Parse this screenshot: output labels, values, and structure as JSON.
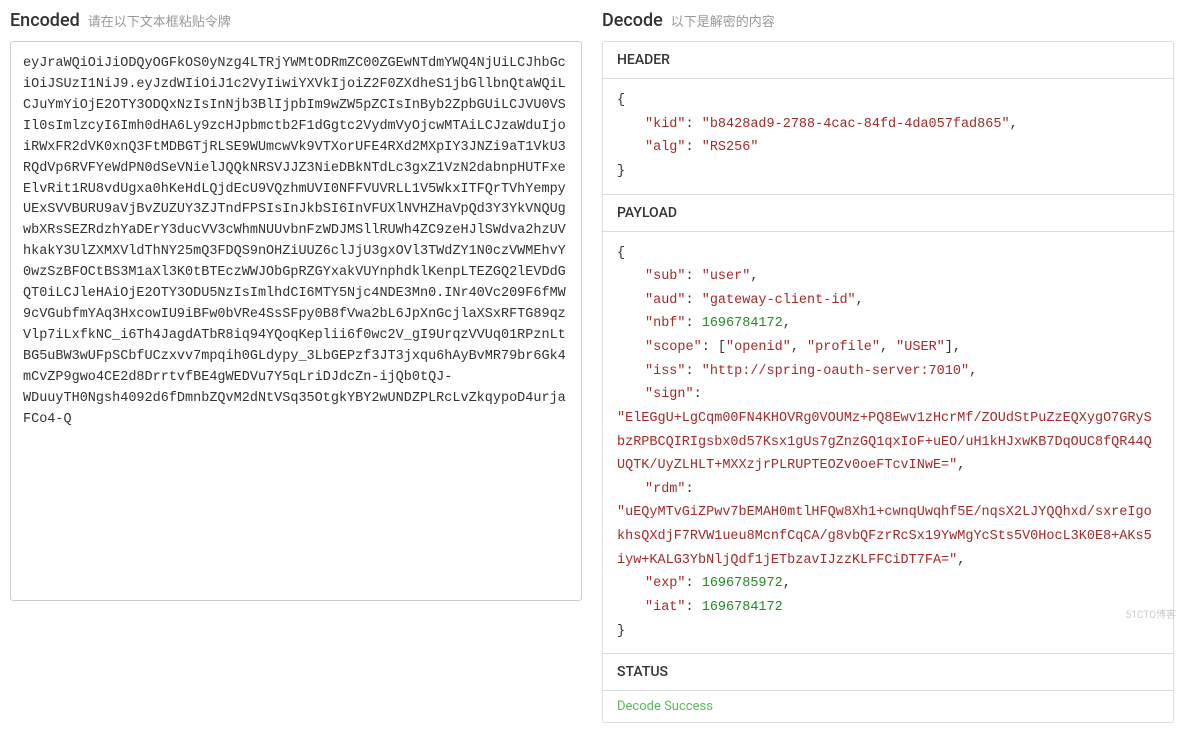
{
  "left": {
    "title": "Encoded",
    "subtitle": "请在以下文本框粘贴令牌",
    "token": "eyJraWQiOiJiODQyOGFkOS0yNzg4LTRjYWMtODRmZC00ZGEwNTdmYWQ4NjUiLCJhbGciOiJSUzI1NiJ9.eyJzdWIiOiJ1c2VyIiwiYXVkIjoiZ2F0ZXdheS1jbGllbnQtaWQiLCJuYmYiOjE2OTY3ODQxNzIsInNjb3BlIjpbIm9wZW5pZCIsInByb2ZpbGUiLCJVU0VSIl0sImlzcyI6Imh0dHA6Ly9zcHJpbmctb2F1dGgtc2VydmVyOjcwMTAiLCJzaWduIjoiRWxFR2dVK0xnQ3FtMDBGTjRLSE9WUmcwVk9VTXorUFE4RXd2MXpIY3JNZi9aT1VkU3RQdVp6RVFYeWdPN0dSeVNielJQQkNRSVJJZ3NieDBkNTdLc3gxZ1VzN2dabnpHUTFxeElvRit1RU8vdUgxa0hKeHdLQjdEcU9VQzhmUVI0NFFVUVRLL1V5WkxITFQrTVhYempyUExSVVBURU9aVjBvZUZUY3ZJTndFPSIsInJkbSI6InVFUXlNVHZHaVpQd3Y3YkVNQUgwbXRsSEZRdzhYaDErY3ducVV3cWhmNUUvbnFzWDJMSllRUWh4ZC9zeHJlSWdva2hzUVhkakY3UlZXMXVldThNY25mQ3FDQS9nOHZiUUZ6clJjU3gxOVl3TWdZY1N0czVWMEhvY0wzSzBFOCtBS3M1aXl3K0tBTEczWWJObGpRZGYxakVUYnphdklKenpLTEZGQ2lEVDdGQT0iLCJleHAiOjE2OTY3ODU5NzIsImlhdCI6MTY5Njc4NDE3Mn0.INr40Vc209F6fMW9cVGubfmYAq3HxcowIU9iBFw0bVRe4SsSFpy0B8fVwa2bL6JpXnGcjlaXSxRFTG89qzVlp7iLxfkNC_i6Th4JagdATbR8iq94YQoqKeplii6f0wc2V_gI9UrqzVVUq01RPznLtBG5uBW3wUFpSCbfUCzxvv7mpqih0GLdypy_3LbGEPzf3JT3jxqu6hAyBvMR79br6Gk4mCvZP9gwo4CE2d8DrrtvfBE4gWEDVu7Y5qLriDJdcZn-ijQb0tQJ-\nWDuuyTH0Ngsh4092d6fDmnbZQvM2dNtVSq35OtgkYBY2wUNDZPLRcLvZkqypoD4urjaFCo4-Q"
  },
  "right": {
    "title": "Decode",
    "subtitle": "以下是解密的内容",
    "header_title": "HEADER",
    "header_obj": {
      "kid": "b8428ad9-2788-4cac-84fd-4da057fad865",
      "alg": "RS256"
    },
    "payload_title": "PAYLOAD",
    "payload_obj": {
      "sub": "user",
      "aud": "gateway-client-id",
      "nbf": 1696784172,
      "scope": [
        "openid",
        "profile",
        "USER"
      ],
      "iss": "http://spring-oauth-server:7010",
      "sign": "ElEGgU+LgCqm00FN4KHOVRg0VOUMz+PQ8Ewv1zHcrMf/ZOUdStPuZzEQXygO7GRySbzRPBCQIRIgsbx0d57Ksx1gUs7gZnzGQ1qxIoF+uEO/uH1kHJxwKB7DqOUC8fQR44QUQTK/UyZLHLT+MXXzjrPLRUPTEOZv0oeFTcvINwE=",
      "rdm": "uEQyMTvGiZPwv7bEMAH0mtlHFQw8Xh1+cwnqUwqhf5E/nqsX2LJYQQhxd/sxreIgokhsQXdjF7RVW1ueu8McnfCqCA/g8vbQFzrRcSx19YwMgYcSts5V0HocL3K0E8+AKs5iyw+KALG3YbNljQdf1jETbzavIJzzKLFFCiDT7FA=",
      "exp": 1696785972,
      "iat": 1696784172
    },
    "status_title": "STATUS",
    "status_text": "Decode Success"
  },
  "watermark": "51CTO博客"
}
